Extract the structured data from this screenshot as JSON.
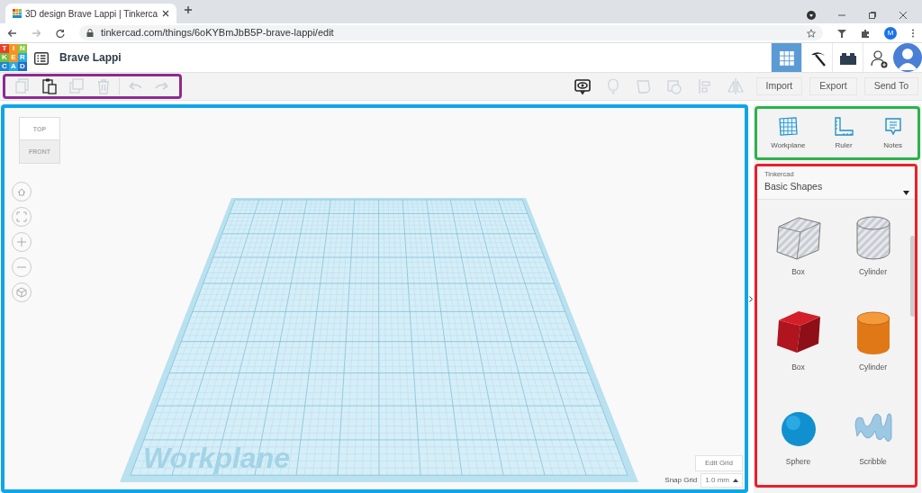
{
  "browser": {
    "tab_title": "3D design Brave Lappi | Tinkerca",
    "url": "tinkercad.com/things/6oKYBmJbB5P-brave-lappi/edit",
    "profile_initial": "M"
  },
  "app": {
    "logo_letters": [
      "T",
      "I",
      "N",
      "K",
      "E",
      "R",
      "C",
      "A",
      "D"
    ],
    "design_name": "Brave Lappi",
    "views": [
      {
        "kind": "grid",
        "selected": true
      },
      {
        "kind": "pickaxe",
        "selected": false
      },
      {
        "kind": "bricks",
        "selected": false
      }
    ]
  },
  "edit_tools": [
    {
      "kind": "copy",
      "disabled": true
    },
    {
      "kind": "paste",
      "disabled": false
    },
    {
      "kind": "duplicate",
      "disabled": true
    },
    {
      "kind": "delete",
      "disabled": true
    },
    {
      "kind": "undo",
      "disabled": true
    },
    {
      "kind": "redo",
      "disabled": true
    }
  ],
  "view_tools": [
    {
      "kind": "notes",
      "disabled": false
    },
    {
      "kind": "bulb",
      "disabled": true
    },
    {
      "kind": "group",
      "disabled": true
    },
    {
      "kind": "ungroup",
      "disabled": true
    },
    {
      "kind": "align",
      "disabled": true
    },
    {
      "kind": "mirror",
      "disabled": true
    }
  ],
  "actions": [
    "Import",
    "Export",
    "Send To"
  ],
  "place_tools": [
    {
      "kind": "workplane",
      "label": "Workplane"
    },
    {
      "kind": "ruler",
      "label": "Ruler"
    },
    {
      "kind": "notes",
      "label": "Notes"
    }
  ],
  "view_cube": {
    "top": "TOP",
    "front": "FRONT"
  },
  "nav_controls": [
    {
      "kind": "home"
    },
    {
      "kind": "fit"
    },
    {
      "kind": "zoom-in"
    },
    {
      "kind": "zoom-out"
    },
    {
      "kind": "perspective"
    }
  ],
  "workplane": {
    "label": "Workplane"
  },
  "edit_grid": "Edit Grid",
  "snap_grid": {
    "label": "Snap Grid",
    "value": "1.0 mm"
  },
  "library": {
    "source": "Tinkercad",
    "category": "Basic Shapes",
    "shapes": [
      {
        "kind": "box-hole",
        "label": "Box"
      },
      {
        "kind": "cylinder-hole",
        "label": "Cylinder"
      },
      {
        "kind": "box",
        "label": "Box"
      },
      {
        "kind": "cylinder",
        "label": "Cylinder"
      },
      {
        "kind": "sphere",
        "label": "Sphere"
      },
      {
        "kind": "scribble",
        "label": "Scribble"
      }
    ]
  }
}
